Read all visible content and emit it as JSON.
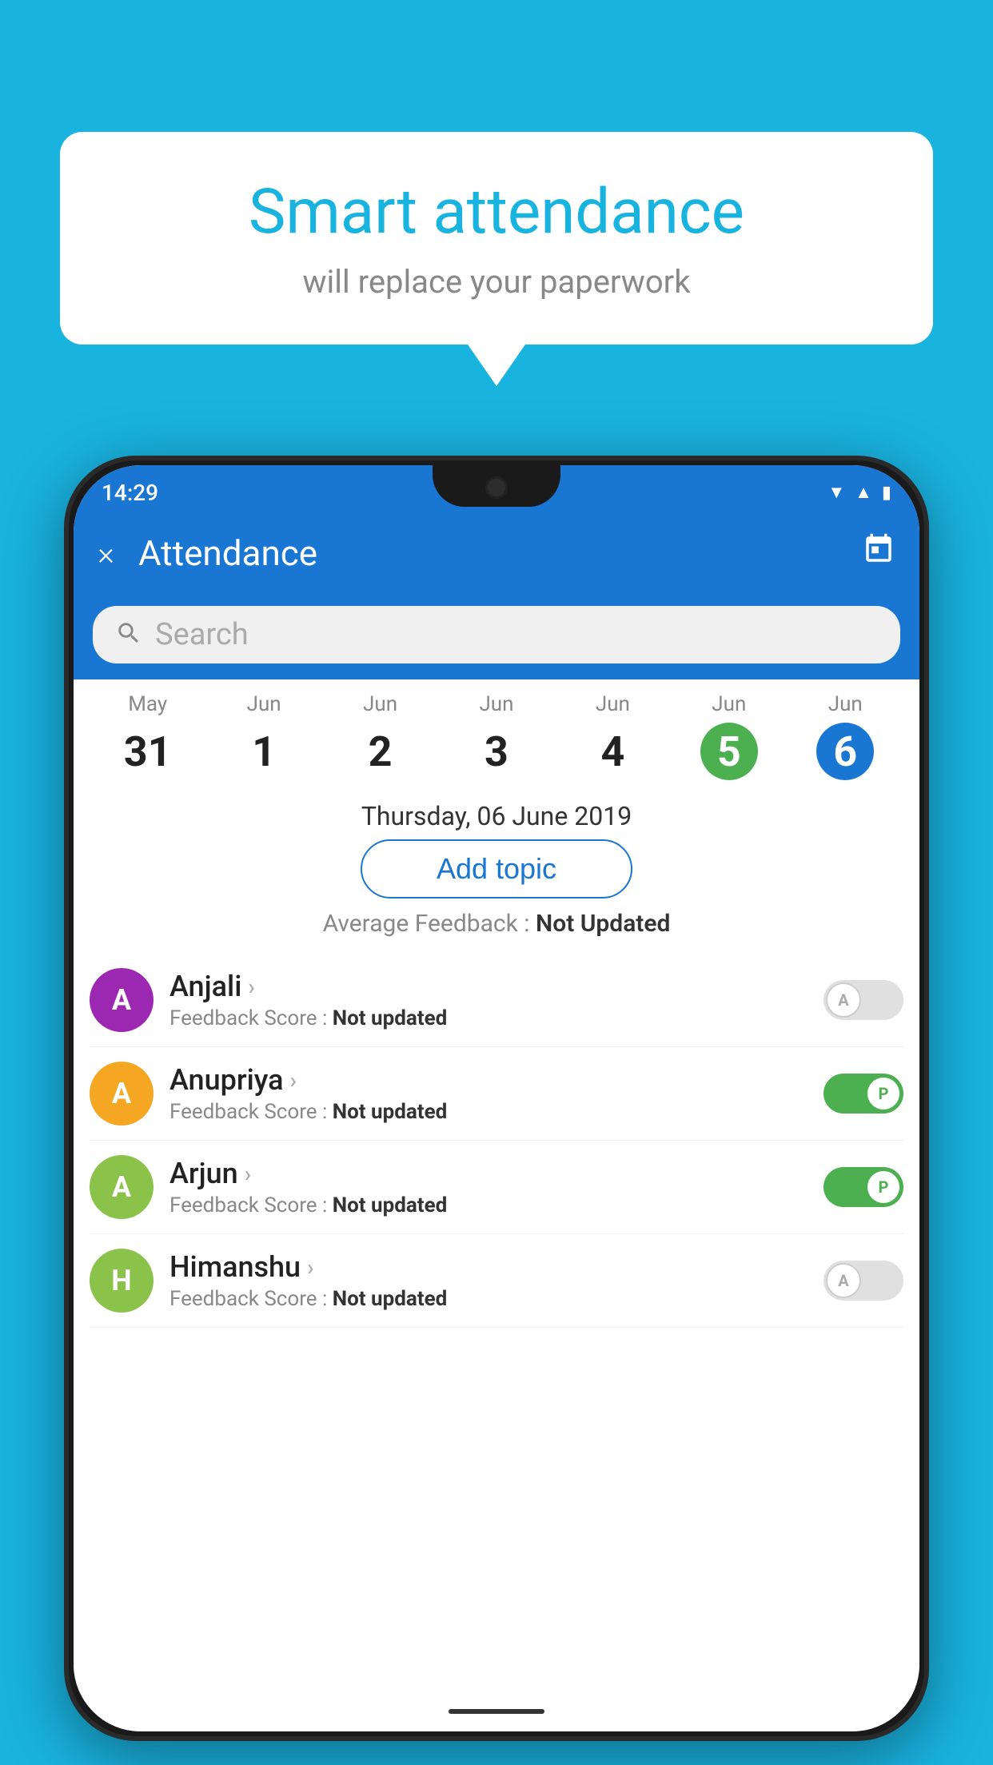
{
  "background": {
    "color": "#19b3e0"
  },
  "speech_bubble": {
    "title": "Smart attendance",
    "subtitle": "will replace your paperwork"
  },
  "status_bar": {
    "time": "14:29",
    "icons": [
      "wifi",
      "signal",
      "battery"
    ]
  },
  "app_bar": {
    "title": "Attendance",
    "close_label": "×",
    "calendar_label": "📅"
  },
  "search": {
    "placeholder": "Search"
  },
  "dates": [
    {
      "month": "May",
      "day": "31",
      "highlight": "none"
    },
    {
      "month": "Jun",
      "day": "1",
      "highlight": "none"
    },
    {
      "month": "Jun",
      "day": "2",
      "highlight": "none"
    },
    {
      "month": "Jun",
      "day": "3",
      "highlight": "none"
    },
    {
      "month": "Jun",
      "day": "4",
      "highlight": "none"
    },
    {
      "month": "Jun",
      "day": "5",
      "highlight": "today"
    },
    {
      "month": "Jun",
      "day": "6",
      "highlight": "selected"
    }
  ],
  "selected_date_label": "Thursday, 06 June 2019",
  "add_topic_label": "Add topic",
  "avg_feedback_label": "Average Feedback : ",
  "avg_feedback_value": "Not Updated",
  "students": [
    {
      "name": "Anjali",
      "avatar_letter": "A",
      "avatar_color": "#9c27b0",
      "feedback_label": "Feedback Score : ",
      "feedback_value": "Not updated",
      "toggle_state": "off",
      "toggle_letter": "A"
    },
    {
      "name": "Anupriya",
      "avatar_letter": "A",
      "avatar_color": "#f5a623",
      "feedback_label": "Feedback Score : ",
      "feedback_value": "Not updated",
      "toggle_state": "on",
      "toggle_letter": "P"
    },
    {
      "name": "Arjun",
      "avatar_letter": "A",
      "avatar_color": "#8bc34a",
      "feedback_label": "Feedback Score : ",
      "feedback_value": "Not updated",
      "toggle_state": "on",
      "toggle_letter": "P"
    },
    {
      "name": "Himanshu",
      "avatar_letter": "H",
      "avatar_color": "#8bc34a",
      "feedback_label": "Feedback Score : ",
      "feedback_value": "Not updated",
      "toggle_state": "off",
      "toggle_letter": "A"
    }
  ]
}
